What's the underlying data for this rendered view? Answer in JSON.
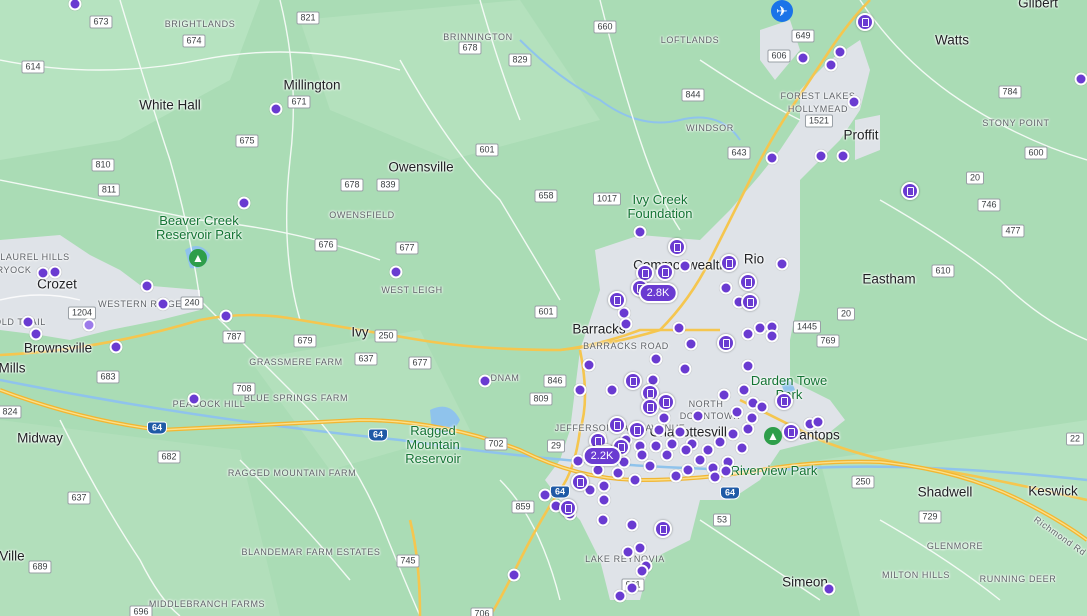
{
  "labels": [
    {
      "text": "Gilbert",
      "cls": "town"
    },
    {
      "text": "BRIGHTLANDS",
      "cls": "small"
    },
    {
      "text": "BRINNINGTON",
      "cls": "small"
    },
    {
      "text": "LOFTLANDS",
      "cls": "small"
    },
    {
      "text": "Watts",
      "cls": "town"
    },
    {
      "text": "Millington",
      "cls": "town"
    },
    {
      "text": "White Hall",
      "cls": "town"
    },
    {
      "text": "FOREST LAKES",
      "cls": "small"
    },
    {
      "text": "HOLLYMEAD",
      "cls": "small"
    },
    {
      "text": "WINDSOR",
      "cls": "small"
    },
    {
      "text": "STONY POINT",
      "cls": "small"
    },
    {
      "text": "Proffit",
      "cls": "town"
    },
    {
      "text": "Owensville",
      "cls": "town"
    },
    {
      "text": "OWENSFIELD",
      "cls": "small"
    },
    {
      "text": "LAUREL HILLS",
      "cls": "small"
    },
    {
      "text": "RYOCK",
      "cls": "small"
    },
    {
      "text": "Crozet",
      "cls": "town"
    },
    {
      "text": "WESTERN RIDGE",
      "cls": "small"
    },
    {
      "text": "OLD TRAIL",
      "cls": "small"
    },
    {
      "text": "Brownsville",
      "cls": "town"
    },
    {
      "text": "Mills",
      "cls": "town"
    },
    {
      "text": "WEST LEIGH",
      "cls": "small"
    },
    {
      "text": "Ivy",
      "cls": "town"
    },
    {
      "text": "Commonwealth",
      "cls": "town"
    },
    {
      "text": "Rio",
      "cls": "town"
    },
    {
      "text": "Eastham",
      "cls": "town"
    },
    {
      "text": "Barracks",
      "cls": "town"
    },
    {
      "text": "BARRACKS ROAD",
      "cls": "small"
    },
    {
      "text": "GRASSMERE FARM",
      "cls": "small"
    },
    {
      "text": "BLUE SPRINGS FARM",
      "cls": "small"
    },
    {
      "text": "PEACOCK HILL",
      "cls": "small"
    },
    {
      "text": "DNAM",
      "cls": "small"
    },
    {
      "text": "NORTH",
      "cls": "small"
    },
    {
      "text": "DOWNTOWN",
      "cls": "small"
    },
    {
      "text": "Charlottesville",
      "cls": "town"
    },
    {
      "text": "Pantops",
      "cls": "town"
    },
    {
      "text": "Midway",
      "cls": "town"
    },
    {
      "text": "RAGGED MOUNTAIN FARM",
      "cls": "small"
    },
    {
      "text": "JEFFERSON PARK AVENUE",
      "cls": "small"
    },
    {
      "text": "Shadwell",
      "cls": "town"
    },
    {
      "text": "Keswick",
      "cls": "town"
    },
    {
      "text": "Richmond Rd",
      "cls": "small"
    },
    {
      "text": "BLANDEMAR FARM ESTATES",
      "cls": "small"
    },
    {
      "text": "LAKE REYNOVIA",
      "cls": "small"
    },
    {
      "text": "GLENMORE",
      "cls": "small"
    },
    {
      "text": "MILTON HILLS",
      "cls": "small"
    },
    {
      "text": "RUNNING DEER",
      "cls": "small"
    },
    {
      "text": "Simeon",
      "cls": "town"
    },
    {
      "text": "MIDDLEBRANCH FARMS",
      "cls": "small"
    },
    {
      "text": "Ville",
      "cls": "town"
    }
  ],
  "parks": [
    {
      "text": "Ivy Creek Foundation"
    },
    {
      "text": "Beaver Creek Reservoir Park"
    },
    {
      "text": "Ragged Mountain Reservoir"
    },
    {
      "text": "Darden Towe Park"
    },
    {
      "text": "Riverview Park"
    }
  ],
  "shields": [
    {
      "text": "673"
    },
    {
      "text": "821"
    },
    {
      "text": "674"
    },
    {
      "text": "660"
    },
    {
      "text": "649"
    },
    {
      "text": "614"
    },
    {
      "text": "678"
    },
    {
      "text": "829"
    },
    {
      "text": "606"
    },
    {
      "text": "671"
    },
    {
      "text": "784"
    },
    {
      "text": "1521"
    },
    {
      "text": "844"
    },
    {
      "text": "675"
    },
    {
      "text": "601"
    },
    {
      "text": "643"
    },
    {
      "text": "600"
    },
    {
      "text": "810"
    },
    {
      "text": "678"
    },
    {
      "text": "839"
    },
    {
      "text": "20"
    },
    {
      "text": "811"
    },
    {
      "text": "658"
    },
    {
      "text": "1017"
    },
    {
      "text": "746"
    },
    {
      "text": "477"
    },
    {
      "text": "676"
    },
    {
      "text": "677"
    },
    {
      "text": "610"
    },
    {
      "text": "240"
    },
    {
      "text": "1204"
    },
    {
      "text": "601"
    },
    {
      "text": "20"
    },
    {
      "text": "1445"
    },
    {
      "text": "787"
    },
    {
      "text": "679"
    },
    {
      "text": "250"
    },
    {
      "text": "637"
    },
    {
      "text": "677"
    },
    {
      "text": "769"
    },
    {
      "text": "683"
    },
    {
      "text": "846"
    },
    {
      "text": "708"
    },
    {
      "text": "809"
    },
    {
      "text": "824"
    },
    {
      "text": "702"
    },
    {
      "text": "29"
    },
    {
      "text": "682"
    },
    {
      "text": "250"
    },
    {
      "text": "22"
    },
    {
      "text": "637"
    },
    {
      "text": "859"
    },
    {
      "text": "53"
    },
    {
      "text": "729"
    },
    {
      "text": "689"
    },
    {
      "text": "745"
    },
    {
      "text": "696"
    },
    {
      "text": "706"
    },
    {
      "text": "631"
    }
  ],
  "interstates": [
    {
      "text": "64"
    },
    {
      "text": "64"
    },
    {
      "text": "64"
    },
    {
      "text": "64"
    }
  ],
  "clusters": [
    {
      "text": "2.8K"
    },
    {
      "text": "2.2K"
    }
  ],
  "airport_icon": "airplane-icon",
  "colors": {
    "land": "#aadcb5",
    "urban": "#dfe3e8",
    "water": "#8fc3ec",
    "road": "#f5c64f",
    "pin": "#6a3bd1"
  }
}
